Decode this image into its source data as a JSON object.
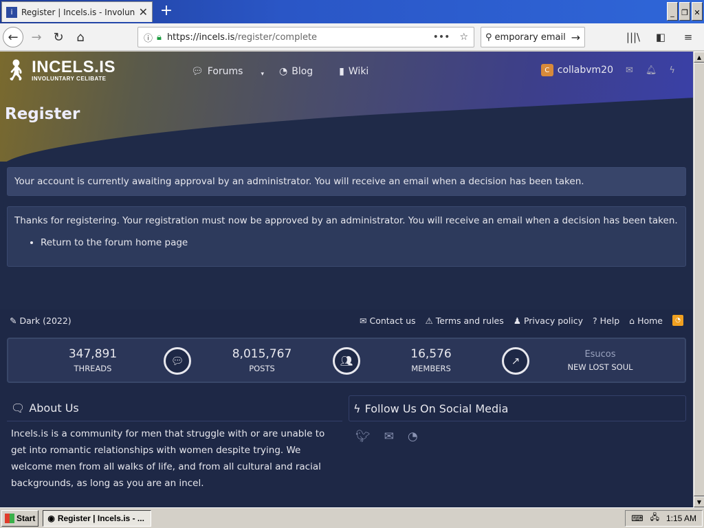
{
  "browser": {
    "tab_title": "Register | Incels.is - Involuntary Ce",
    "tab_close": "✕",
    "new_tab": "+",
    "url_host": "https://incels.is",
    "url_path": "/register/complete",
    "search_text": "emporary email",
    "window_buttons": {
      "minimize": "_",
      "restore": "❐",
      "close": "✕"
    }
  },
  "site": {
    "logo_name": "INCELS.IS",
    "logo_tagline": "INVOLUNTARY CELIBATE",
    "nav": [
      {
        "label": "Forums",
        "icon": "forums-icon"
      },
      {
        "label": "Blog",
        "icon": "rss-icon"
      },
      {
        "label": "Wiki",
        "icon": "book-icon"
      }
    ],
    "user": {
      "avatar_letter": "C",
      "name": "collabvm20",
      "avatar_color": "#d88a3a"
    }
  },
  "page": {
    "title": "Register",
    "notice": "Your account is currently awaiting approval by an administrator. You will receive an email when a decision has been taken.",
    "message": "Thanks for registering. Your registration must now be approved by an administrator. You will receive an email when a decision has been taken.",
    "return_link": "Return to the forum home page"
  },
  "footer": {
    "style_chooser": "Dark (2022)",
    "links": [
      "Contact us",
      "Terms and rules",
      "Privacy policy",
      "Help",
      "Home"
    ],
    "stats": [
      {
        "value": "347,891",
        "label": "THREADS"
      },
      {
        "value": "8,015,767",
        "label": "POSTS"
      },
      {
        "value": "16,576",
        "label": "MEMBERS"
      },
      {
        "value": "Esucos",
        "label": "NEW LOST SOUL"
      }
    ],
    "about_title": "About Us",
    "about_text": "Incels.is is a community for men that struggle with or are unable to get into romantic relationships with women despite trying. We welcome men from all walks of life, and from all cultural and racial backgrounds, as long as you are an incel.",
    "social_title": "Follow Us On Social Media",
    "social_icons": [
      "twitter-icon",
      "email-icon",
      "rss-icon"
    ]
  },
  "taskbar": {
    "start_label": "Start",
    "task_label": "Register | Incels.is - ...",
    "clock": "1:15 AM"
  },
  "colors": {
    "page_bg": "#1f2a48",
    "panel_bg": "#2d3a5c",
    "accent_orange": "#f0a020"
  }
}
